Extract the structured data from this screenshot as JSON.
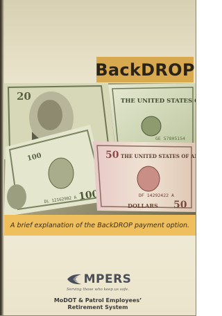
{
  "cover": {
    "title": "BackDROP",
    "caption": "A brief explanation of the BackDROP payment option.",
    "logo_text": "MPERS",
    "tagline": "Serving those who keep us safe.",
    "org_line1": "MoDOT & Patrol Employees’",
    "org_line2": "Retirement System"
  },
  "photo": {
    "note_text_1": "THE UNITED STATES OF AMERICA",
    "note_serial_1": "GE 57805154",
    "note_serial_2": "DL 12162982 A",
    "note_serial_3": "DF 14292422 A",
    "denomination_20": "20",
    "denomination_50": "50",
    "denomination_100": "100",
    "dollars_word": "DOLLARS"
  },
  "colors": {
    "title_box": "#d9a94f",
    "caption_band": "#efbf5e",
    "background": "#f2eedc"
  }
}
